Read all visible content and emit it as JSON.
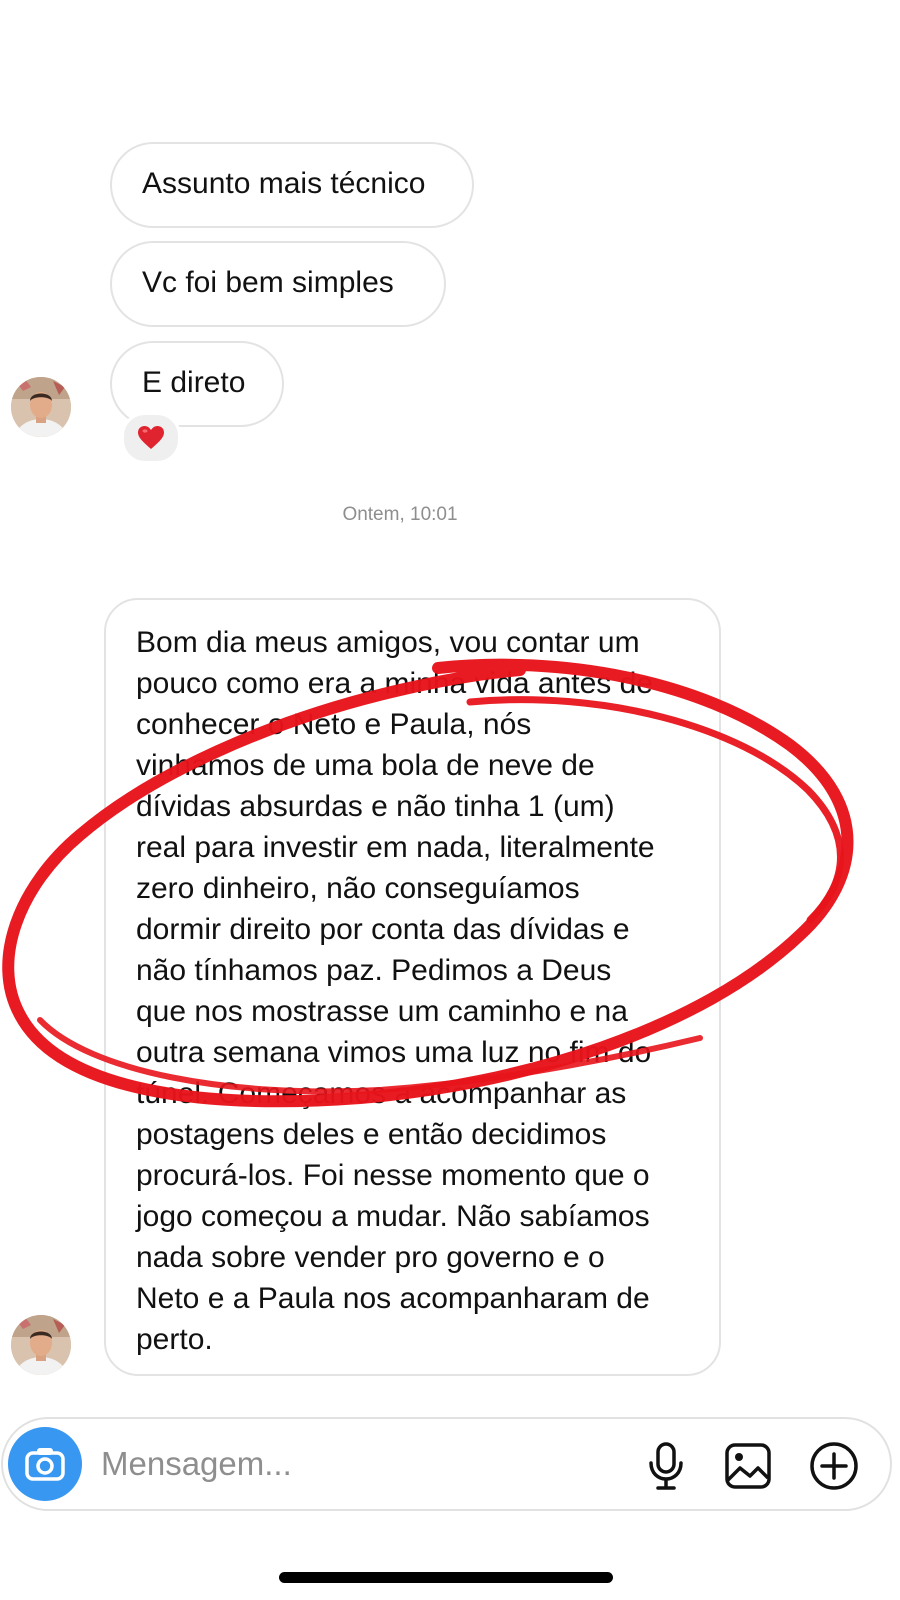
{
  "messages": [
    {
      "text": "Assunto mais técnico"
    },
    {
      "text": "Vc foi bem simples"
    },
    {
      "text": "E direto",
      "reaction": "❤️"
    }
  ],
  "timestamp": "Ontem, 10:01",
  "long_message": {
    "lines": [
      "Bom dia meus amigos, vou contar um",
      "pouco como era a minha vida antes de",
      "conhecer o Neto e Paula, nós",
      "vinhamos de uma bola de neve de",
      "dívidas absurdas e não tinha 1 (um)",
      "real para investir em nada, literalmente",
      "zero dinheiro, não conseguíamos",
      "dormir direito por conta das dívidas e",
      "não tínhamos paz. Pedimos a Deus",
      "que nos mostrasse um caminho e na",
      "outra semana vimos uma luz no fim do",
      "túnel. Começamos a acompanhar as",
      "postagens deles e então decidimos",
      "procurá-los. Foi nesse momento que o",
      "jogo começou a mudar. Não sabíamos",
      "nada sobre vender pro governo e o",
      "Neto e a Paula nos acompanharam de",
      "perto."
    ]
  },
  "composer": {
    "placeholder": "Mensagem...",
    "icons": [
      "camera-icon",
      "microphone-icon",
      "gallery-icon",
      "plus-circle-icon"
    ]
  },
  "colors": {
    "accent": "#3897f0",
    "annotation": "#e8141b",
    "bubble_border": "#e3e3e3",
    "timestamp": "#8e8e8e"
  }
}
